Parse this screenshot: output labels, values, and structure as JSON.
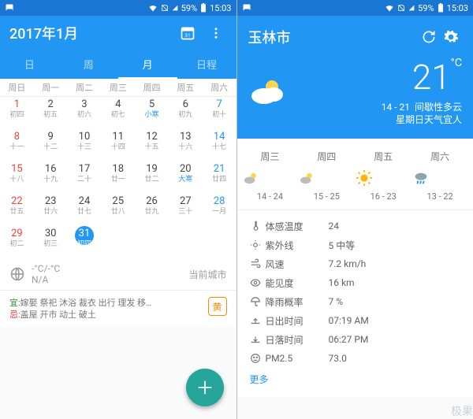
{
  "statusbar": {
    "battery_pct": "59%",
    "time": "15:03"
  },
  "calendar": {
    "title": "2017年1月",
    "tabs": {
      "d": "日",
      "w": "周",
      "m": "月",
      "a": "日程",
      "sel": "m"
    },
    "dow": [
      "周日",
      "周一",
      "周二",
      "周三",
      "周四",
      "周五",
      "周六"
    ],
    "weeks": [
      [
        [
          "1",
          "初四",
          "sun"
        ],
        [
          "2",
          "初五",
          ""
        ],
        [
          "3",
          "初六",
          ""
        ],
        [
          "4",
          "初七",
          ""
        ],
        [
          "5",
          "小寒",
          "jie"
        ],
        [
          "6",
          "初九",
          ""
        ],
        [
          "7",
          "初十",
          "sat"
        ]
      ],
      [
        [
          "8",
          "十一",
          "sun"
        ],
        [
          "9",
          "十二",
          ""
        ],
        [
          "10",
          "十三",
          ""
        ],
        [
          "11",
          "十四",
          ""
        ],
        [
          "12",
          "十五",
          ""
        ],
        [
          "13",
          "十六",
          ""
        ],
        [
          "14",
          "十七",
          "sat"
        ]
      ],
      [
        [
          "15",
          "十八",
          "sun"
        ],
        [
          "16",
          "十九",
          ""
        ],
        [
          "17",
          "二十",
          ""
        ],
        [
          "18",
          "廿一",
          ""
        ],
        [
          "19",
          "廿二",
          ""
        ],
        [
          "20",
          "大寒",
          "jie"
        ],
        [
          "21",
          "廿四",
          "sat"
        ]
      ],
      [
        [
          "22",
          "廿五",
          "sun"
        ],
        [
          "23",
          "廿六",
          ""
        ],
        [
          "24",
          "廿七",
          ""
        ],
        [
          "25",
          "廿八",
          ""
        ],
        [
          "26",
          "廿九",
          ""
        ],
        [
          "27",
          "三十",
          ""
        ],
        [
          "28",
          "一月",
          "sat"
        ]
      ],
      [
        [
          "29",
          "初二",
          "sun"
        ],
        [
          "30",
          "初三",
          ""
        ],
        [
          "31",
          "初四",
          "today"
        ],
        [
          "",
          "",
          ""
        ],
        [
          "",
          "",
          ""
        ],
        [
          "",
          "",
          ""
        ],
        [
          "",
          "",
          ""
        ]
      ]
    ],
    "city_temp": "-°C/-°C",
    "city_sub": "N/A",
    "city_label": "当前城市",
    "almanac_yi_label": "宜:",
    "almanac_yi": "嫁娶 祭祀 沐浴 裁衣 出行 理发 移…",
    "almanac_ji_label": "忌:",
    "almanac_ji": "盖屋 开市 动土 破土",
    "zodiac": "黄"
  },
  "weather": {
    "city": "玉林市",
    "now_temp": "21",
    "now_unit": "°C",
    "range": "14 - 21",
    "cond": "间歇性多云",
    "sub": "星期日天气宜人",
    "forecast": [
      {
        "d": "周三",
        "icon": "pc",
        "r": "14 - 24"
      },
      {
        "d": "周四",
        "icon": "pc",
        "r": "15 - 25"
      },
      {
        "d": "周五",
        "icon": "sun",
        "r": "16 - 23"
      },
      {
        "d": "周六",
        "icon": "rain",
        "r": "13 - 22"
      }
    ],
    "details": [
      {
        "k": "体感温度",
        "v": "24",
        "ic": "therm"
      },
      {
        "k": "紫外线",
        "v": "5 中等",
        "ic": "uv"
      },
      {
        "k": "风速",
        "v": "7.2 km/h",
        "ic": "wind"
      },
      {
        "k": "能见度",
        "v": "16 km",
        "ic": "eye"
      },
      {
        "k": "降雨概率",
        "v": "7 %",
        "ic": "umbr"
      },
      {
        "k": "日出时间",
        "v": "07:19 AM",
        "ic": "up"
      },
      {
        "k": "日落时间",
        "v": "06:27 PM",
        "ic": "down"
      },
      {
        "k": "PM2.5",
        "v": "73.0",
        "ic": "face"
      }
    ],
    "more": "更多"
  },
  "watermark": "极果"
}
